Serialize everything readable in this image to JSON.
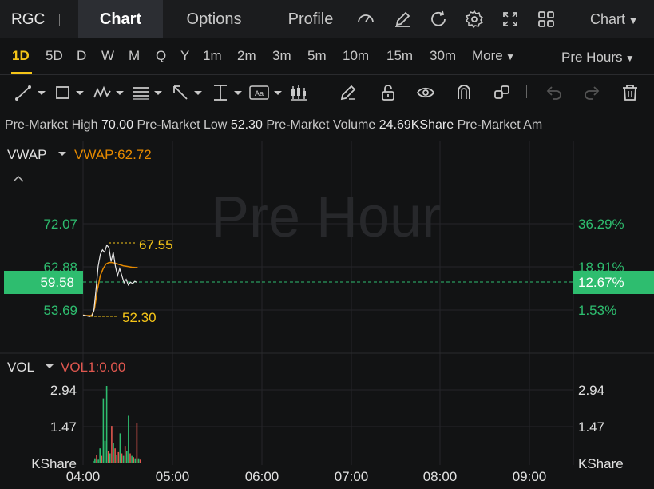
{
  "header": {
    "ticker": "RGC",
    "tabs": [
      {
        "label": "Chart",
        "active": true
      },
      {
        "label": "Options",
        "active": false
      },
      {
        "label": "Profile",
        "active": false
      }
    ],
    "chart_type_dropdown": "Chart"
  },
  "intervals": {
    "items": [
      "1D",
      "5D",
      "D",
      "W",
      "M",
      "Q",
      "Y",
      "1m",
      "2m",
      "3m",
      "5m",
      "10m",
      "15m",
      "30m"
    ],
    "more_label": "More",
    "active": "1D",
    "session_label": "Pre Hours"
  },
  "info": {
    "high_label": "Pre-Market High",
    "high_value": "70.00",
    "low_label": "Pre-Market Low",
    "low_value": "52.30",
    "volume_label": "Pre-Market Volume",
    "volume_value": "24.69KShare",
    "amount_label": "Pre-Market Am"
  },
  "main_panel": {
    "indicator_name": "VWAP",
    "indicator_value": "VWAP:62.72",
    "watermark": "Pre Hour",
    "y_left": [
      "72.07",
      "62.88",
      "53.69"
    ],
    "y_right": [
      "36.29%",
      "18.91%",
      "1.53%"
    ],
    "current_price": "59.58",
    "current_pct": "12.67%",
    "high_label": "67.55",
    "low_label": "52.30"
  },
  "volume_panel": {
    "indicator_name": "VOL",
    "indicator_value": "VOL1:0.00",
    "y_left": [
      "2.94",
      "1.47",
      "KShare"
    ],
    "y_right": [
      "2.94",
      "1.47",
      "KShare"
    ]
  },
  "x_axis": [
    "04:00",
    "05:00",
    "06:00",
    "07:00",
    "08:00",
    "09:00"
  ],
  "colors": {
    "up": "#2ebd6f",
    "down": "#e0574f",
    "accent": "#f5c518",
    "vwap": "#e68a00",
    "current_price_bg": "#2ebd6f"
  },
  "chart_data": {
    "type": "line",
    "price": [
      52.6,
      52.5,
      52.4,
      52.3,
      52.4,
      53.5,
      58,
      63,
      65.5,
      66.5,
      66,
      67.5,
      67.0,
      64,
      66,
      63,
      61,
      62.5,
      61,
      59.5,
      60.2,
      59.0,
      59.6,
      59.3,
      59.8,
      59.58
    ],
    "vwap": [
      52.6,
      52.5,
      52.5,
      52.5,
      54,
      58,
      61,
      62.5,
      63.5,
      63.8,
      63.8,
      63.7,
      63.5,
      63.3,
      63.1,
      63.0,
      62.9,
      62.8,
      62.75,
      62.72
    ],
    "volume": [
      0.1,
      0.2,
      0.35,
      0.15,
      0.6,
      0.3,
      2.6,
      0.9,
      3.1,
      0.5,
      0.4,
      1.5,
      0.8,
      0.6,
      0.35,
      0.45,
      1.2,
      0.4,
      0.3,
      0.7,
      0.5,
      1.9,
      0.4,
      0.3,
      0.25,
      0.2,
      1.6,
      0.2,
      0.15
    ],
    "volume_up": [
      true,
      true,
      false,
      true,
      true,
      false,
      true,
      true,
      true,
      false,
      true,
      false,
      true,
      false,
      true,
      false,
      true,
      false,
      true,
      false,
      true,
      true,
      false,
      true,
      false,
      true,
      false,
      true,
      false
    ],
    "ylim": [
      52.3,
      72.07
    ],
    "vol_ylim": [
      0,
      2.94
    ]
  }
}
